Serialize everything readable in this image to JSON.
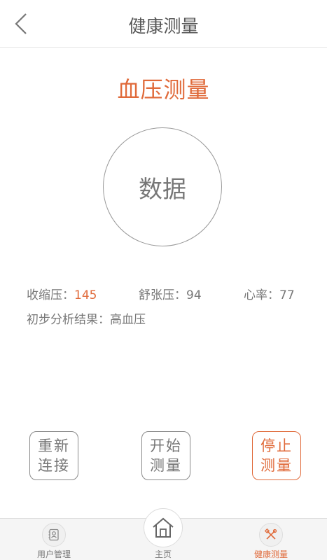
{
  "header": {
    "title": "健康测量"
  },
  "section": {
    "title": "血压测量"
  },
  "circle": {
    "label": "数据"
  },
  "readings": {
    "systolic_label": "收缩压：",
    "systolic_value": "145",
    "diastolic": "舒张压：94",
    "heart_rate": "心率：77"
  },
  "result": {
    "text": "初步分析结果：高血压"
  },
  "actions": {
    "reconnect_line1": "重新",
    "reconnect_line2": "连接",
    "start_line1": "开始",
    "start_line2": "测量",
    "stop_line1": "停止",
    "stop_line2": "测量"
  },
  "tabs": {
    "users": "用户管理",
    "home": "主页",
    "health": "健康测量"
  },
  "colors": {
    "accent": "#e06a3a",
    "text": "#777777"
  }
}
